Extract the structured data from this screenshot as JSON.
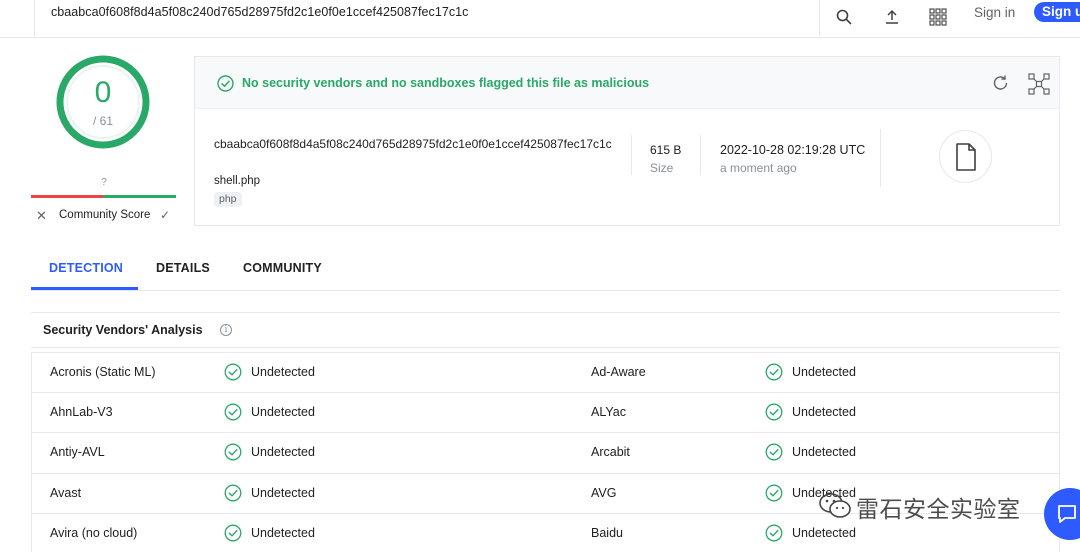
{
  "search": {
    "value": "cbaabca0f608f8d4a5f08c240d765d28975fd2c1e0f0e1ccef425087fec17c1c"
  },
  "topnav": {
    "search_icon": "search-icon",
    "upload_icon": "upload-icon",
    "apps_icon": "apps-grid-icon",
    "sign_in": "Sign in",
    "sign_up": "Sign up"
  },
  "score": {
    "detections": "0",
    "total": "/ 61",
    "community_unknown": "?",
    "community_label": "Community Score"
  },
  "summary": {
    "verdict": "No security vendors and no sandboxes flagged this file as malicious",
    "hash": "cbaabca0f608f8d4a5f08c240d765d28975fd2c1e0f0e1ccef425087fec17c1c",
    "file_name": "shell.php",
    "tag": "php",
    "size_value": "615 B",
    "size_label": "Size",
    "date_value": "2022-10-28 02:19:28 UTC",
    "date_relative": "a moment ago"
  },
  "tabs": [
    {
      "label": "DETECTION",
      "active": true
    },
    {
      "label": "DETAILS",
      "active": false
    },
    {
      "label": "COMMUNITY",
      "active": false
    }
  ],
  "vendors": {
    "title": "Security Vendors' Analysis",
    "rows": [
      {
        "left_name": "Acronis (Static ML)",
        "left_status": "Undetected",
        "right_name": "Ad-Aware",
        "right_status": "Undetected"
      },
      {
        "left_name": "AhnLab-V3",
        "left_status": "Undetected",
        "right_name": "ALYac",
        "right_status": "Undetected"
      },
      {
        "left_name": "Antiy-AVL",
        "left_status": "Undetected",
        "right_name": "Arcabit",
        "right_status": "Undetected"
      },
      {
        "left_name": "Avast",
        "left_status": "Undetected",
        "right_name": "AVG",
        "right_status": "Undetected"
      },
      {
        "left_name": "Avira (no cloud)",
        "left_status": "Undetected",
        "right_name": "Baidu",
        "right_status": "Undetected"
      }
    ]
  },
  "watermark": {
    "text": "雷石安全实验室"
  },
  "colors": {
    "accent": "#2e5bff",
    "clean": "#2aa867",
    "malicious": "#ef4444"
  }
}
